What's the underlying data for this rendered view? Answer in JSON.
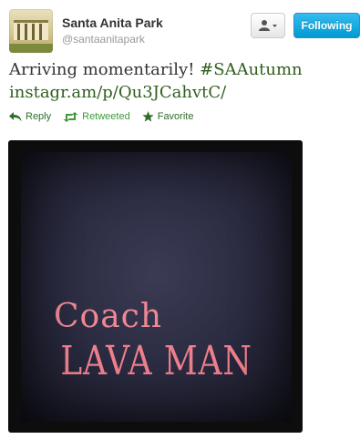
{
  "user": {
    "fullname": "Santa Anita Park",
    "screenname": "@santaanitapark"
  },
  "buttons": {
    "follow_label": "Following"
  },
  "tweet": {
    "text": "Arriving momentarily! ",
    "hashtag": "#SAAutumn",
    "link": "instagr.am/p/Qu3JCahvtC/"
  },
  "actions": {
    "reply": "Reply",
    "retweeted": "Retweeted",
    "favorite": "Favorite"
  },
  "photo": {
    "line1": "Coach",
    "line2": "LAVA MAN"
  },
  "colors": {
    "follow_bg": "#019ad2",
    "link": "#2f5e1e",
    "retweeted": "#3f9a3a",
    "photo_text": "#ef7f8d"
  }
}
